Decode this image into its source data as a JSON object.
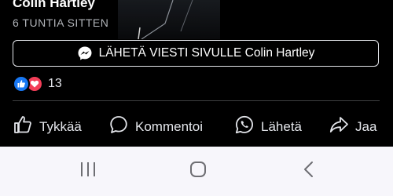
{
  "post": {
    "author": "Colin Hartley",
    "time": "6 TUNTIA SITTEN",
    "message_button": "LÄHETÄ VIESTI SIVULLE Colin Hartley",
    "reaction_count": "13"
  },
  "actions": {
    "like": "Tykkää",
    "comment": "Kommentoi",
    "send": "Lähetä",
    "share": "Jaa"
  },
  "colors": {
    "like_blue": "#1877f2",
    "love_red": "#f33e58",
    "navbar_bg": "#f7f6fb"
  },
  "icons": [
    "messenger-icon",
    "like-reaction-icon",
    "love-reaction-icon",
    "thumbs-up-icon",
    "comment-icon",
    "whatsapp-icon",
    "share-icon",
    "recent-apps-icon",
    "home-icon",
    "back-icon"
  ]
}
